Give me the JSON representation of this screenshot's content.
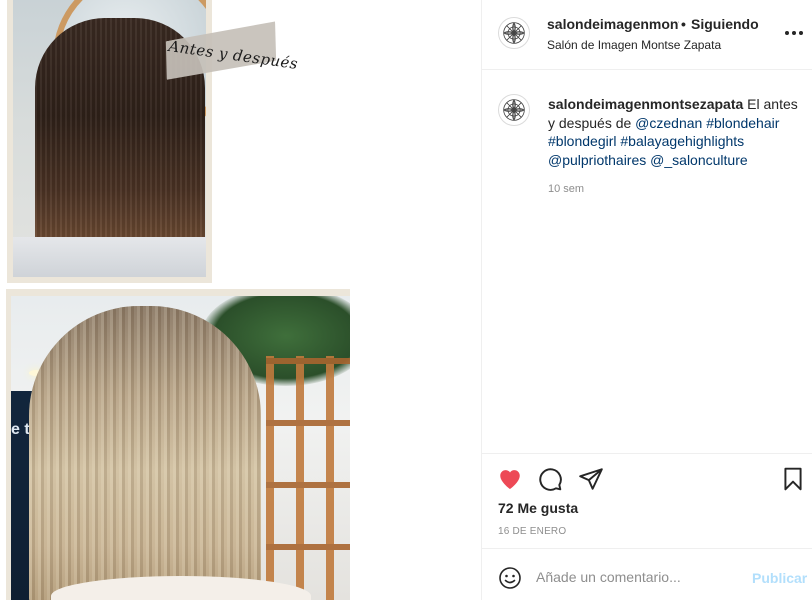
{
  "colors": {
    "like_red": "#ed4956",
    "link_blue": "#00376b",
    "publish_disabled": "#b2dffc",
    "muted_gray": "#8e8e8e",
    "text": "#262626"
  },
  "media": {
    "overlay_label": "Antes y después",
    "wall_text": "e ti"
  },
  "header": {
    "avatar_icon": "mandala-logo-icon",
    "username": "salondeimagenmontsezapata",
    "separator": "•",
    "follow_state": "Siguiendo",
    "location": "Salón de Imagen Montse Zapata",
    "more_icon": "more-options-icon"
  },
  "caption": {
    "username": "salondeimagenmontsezapata",
    "text_before": " El antes y después de ",
    "mention_1": "@czednan",
    "hashtags": [
      "#blondehair",
      "#blondegirl",
      "#balayagehighlights"
    ],
    "mention_2": "@pulpriothaires",
    "mention_3": "@_salonculture",
    "time_ago": "10 sem"
  },
  "actions": {
    "like_icon": "heart-filled-icon",
    "comment_icon": "comment-bubble-icon",
    "share_icon": "paper-plane-icon",
    "save_icon": "bookmark-icon"
  },
  "likes": {
    "label": "72 Me gusta"
  },
  "post_date": "16 DE ENERO",
  "comment_bar": {
    "emoji_icon": "emoji-smile-icon",
    "placeholder": "Añade un comentario...",
    "publish_label": "Publicar"
  }
}
